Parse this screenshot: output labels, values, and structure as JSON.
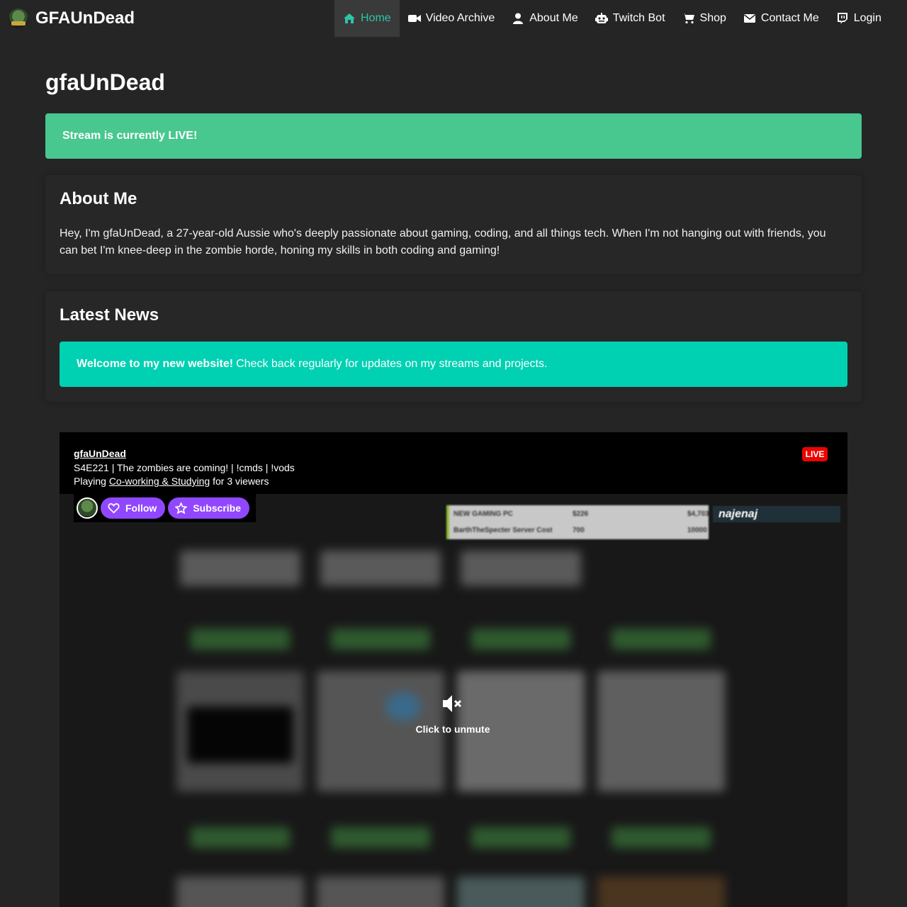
{
  "nav": {
    "brand": "GFAUnDead",
    "items": [
      {
        "label": "Home",
        "icon": "home-icon",
        "active": true
      },
      {
        "label": "Video Archive",
        "icon": "video-camera-icon"
      },
      {
        "label": "About Me",
        "icon": "user-icon"
      },
      {
        "label": "Twitch Bot",
        "icon": "robot-icon"
      },
      {
        "label": "Shop",
        "icon": "shopping-cart-icon"
      },
      {
        "label": "Contact Me",
        "icon": "envelope-icon"
      },
      {
        "label": "Login",
        "icon": "twitch-icon"
      }
    ]
  },
  "page": {
    "title": "gfaUnDead",
    "live_banner": "Stream is currently LIVE!"
  },
  "about": {
    "heading": "About Me",
    "text": "Hey, I'm gfaUnDead, a 27-year-old Aussie who's deeply passionate about gaming, coding, and all things tech. When I'm not hanging out with friends, you can bet I'm knee-deep in the zombie horde, honing my skills in both coding and gaming!"
  },
  "news": {
    "heading": "Latest News",
    "banner_strong": "Welcome to my new website!",
    "banner_text": "Check back regularly for updates on my streams and projects."
  },
  "player": {
    "channel": "gfaUnDead",
    "stream_title": "S4E221 | The zombies are coming! | !cmds | !vods",
    "playing_prefix": "Playing",
    "game": "Co-working & Studying",
    "viewers_text": "for 3 viewers",
    "live_badge": "LIVE",
    "follow_label": "Follow",
    "subscribe_label": "Subscribe",
    "unmute_label": "Click to unmute",
    "overlay": {
      "row1_name": "NEW GAMING PC",
      "row1_amount": "$226",
      "row1_goal": "$4,703",
      "row2_name": "BarthTheSpecter Server Cost",
      "row2_amount": "700",
      "row2_goal": "10000",
      "sponsor": "najenaj"
    }
  },
  "colors": {
    "background": "#252525",
    "active_nav": "#2ec4a6",
    "success": "#48c78e",
    "info": "#00d1b2",
    "twitch_purple": "#9147ff",
    "live_red": "#eb0400"
  }
}
